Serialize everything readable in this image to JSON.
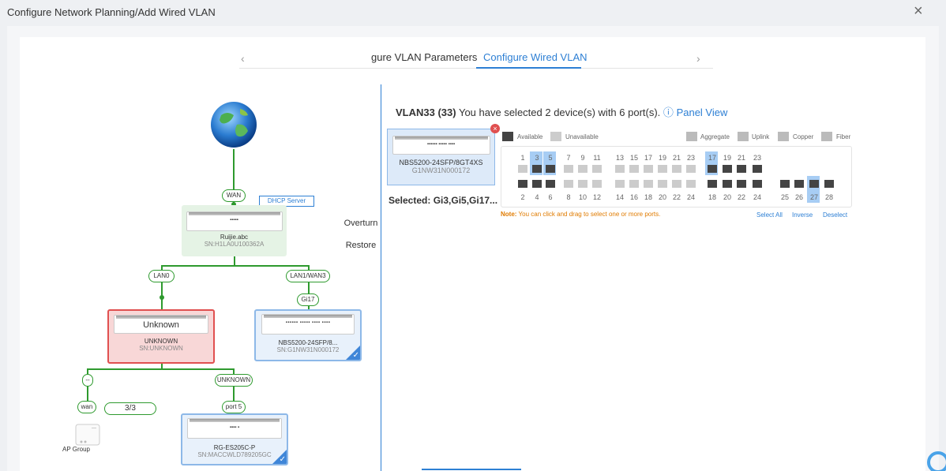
{
  "dialog": {
    "title": "Configure Network Planning/Add Wired VLAN",
    "close": "×"
  },
  "steps": {
    "prev_arrow": "‹",
    "next_arrow": "›",
    "step1": "gure VLAN Parameters",
    "step2": "Configure Wired VLAN"
  },
  "topology": {
    "wan_label": "WAN",
    "dhcp_label": "DHCP Server",
    "router": {
      "name": "Ruijie.abc",
      "sn": "SN:H1LA0U100362A"
    },
    "overturn": "Overturn",
    "restore": "Restore",
    "lan0": "LAN0",
    "lan1wan3": "LAN1/WAN3",
    "gi17": "Gi17",
    "unknown_dev": {
      "title": "Unknown",
      "name": "UNKNOWN",
      "sn": "SN:UNKNOWN"
    },
    "nbs_dev": {
      "name": "NBS5200-24SFP/8...",
      "sn": "SN:G1NW31N000172"
    },
    "dash_label": "--",
    "unknown_link": "UNKNOWN",
    "wan_small": "wan",
    "count": "3/3",
    "port5": "port 5",
    "ap_group": "AP Group",
    "es_dev": {
      "name": "RG-ES205C-P",
      "sn": "SN:MACCWLD789205GC"
    }
  },
  "vlan": {
    "title_bold": "VLAN33 (33)",
    "summary": "You have selected 2 device(s) with 6 port(s).",
    "panel_view": "Panel View",
    "device": {
      "model": "NBS5200-24SFP/8GT4XS",
      "sn": "G1NW31N000172"
    },
    "selected": "Selected: Gi3,Gi5,Gi17...",
    "legend": {
      "available": "Available",
      "unavailable": "Unavailable",
      "aggregate": "Aggregate",
      "uplink": "Uplink",
      "copper": "Copper",
      "fiber": "Fiber"
    },
    "top_nums": [
      "1",
      "3",
      "5",
      "7",
      "9",
      "11",
      "13",
      "15",
      "17",
      "19",
      "21",
      "23",
      "17",
      "19",
      "21",
      "23"
    ],
    "bottom_nums": [
      "2",
      "4",
      "6",
      "8",
      "10",
      "12",
      "14",
      "16",
      "18",
      "20",
      "22",
      "24",
      "18",
      "20",
      "22",
      "24",
      "25",
      "26",
      "27",
      "28"
    ],
    "note_label": "Note:",
    "note_text": "You can click and drag to select one or more ports.",
    "select_all": "Select All",
    "inverse": "Inverse",
    "deselect": "Deselect"
  },
  "colors": {
    "accent": "#2d7fd4",
    "green": "#2e9a2e",
    "error": "#e05050"
  }
}
